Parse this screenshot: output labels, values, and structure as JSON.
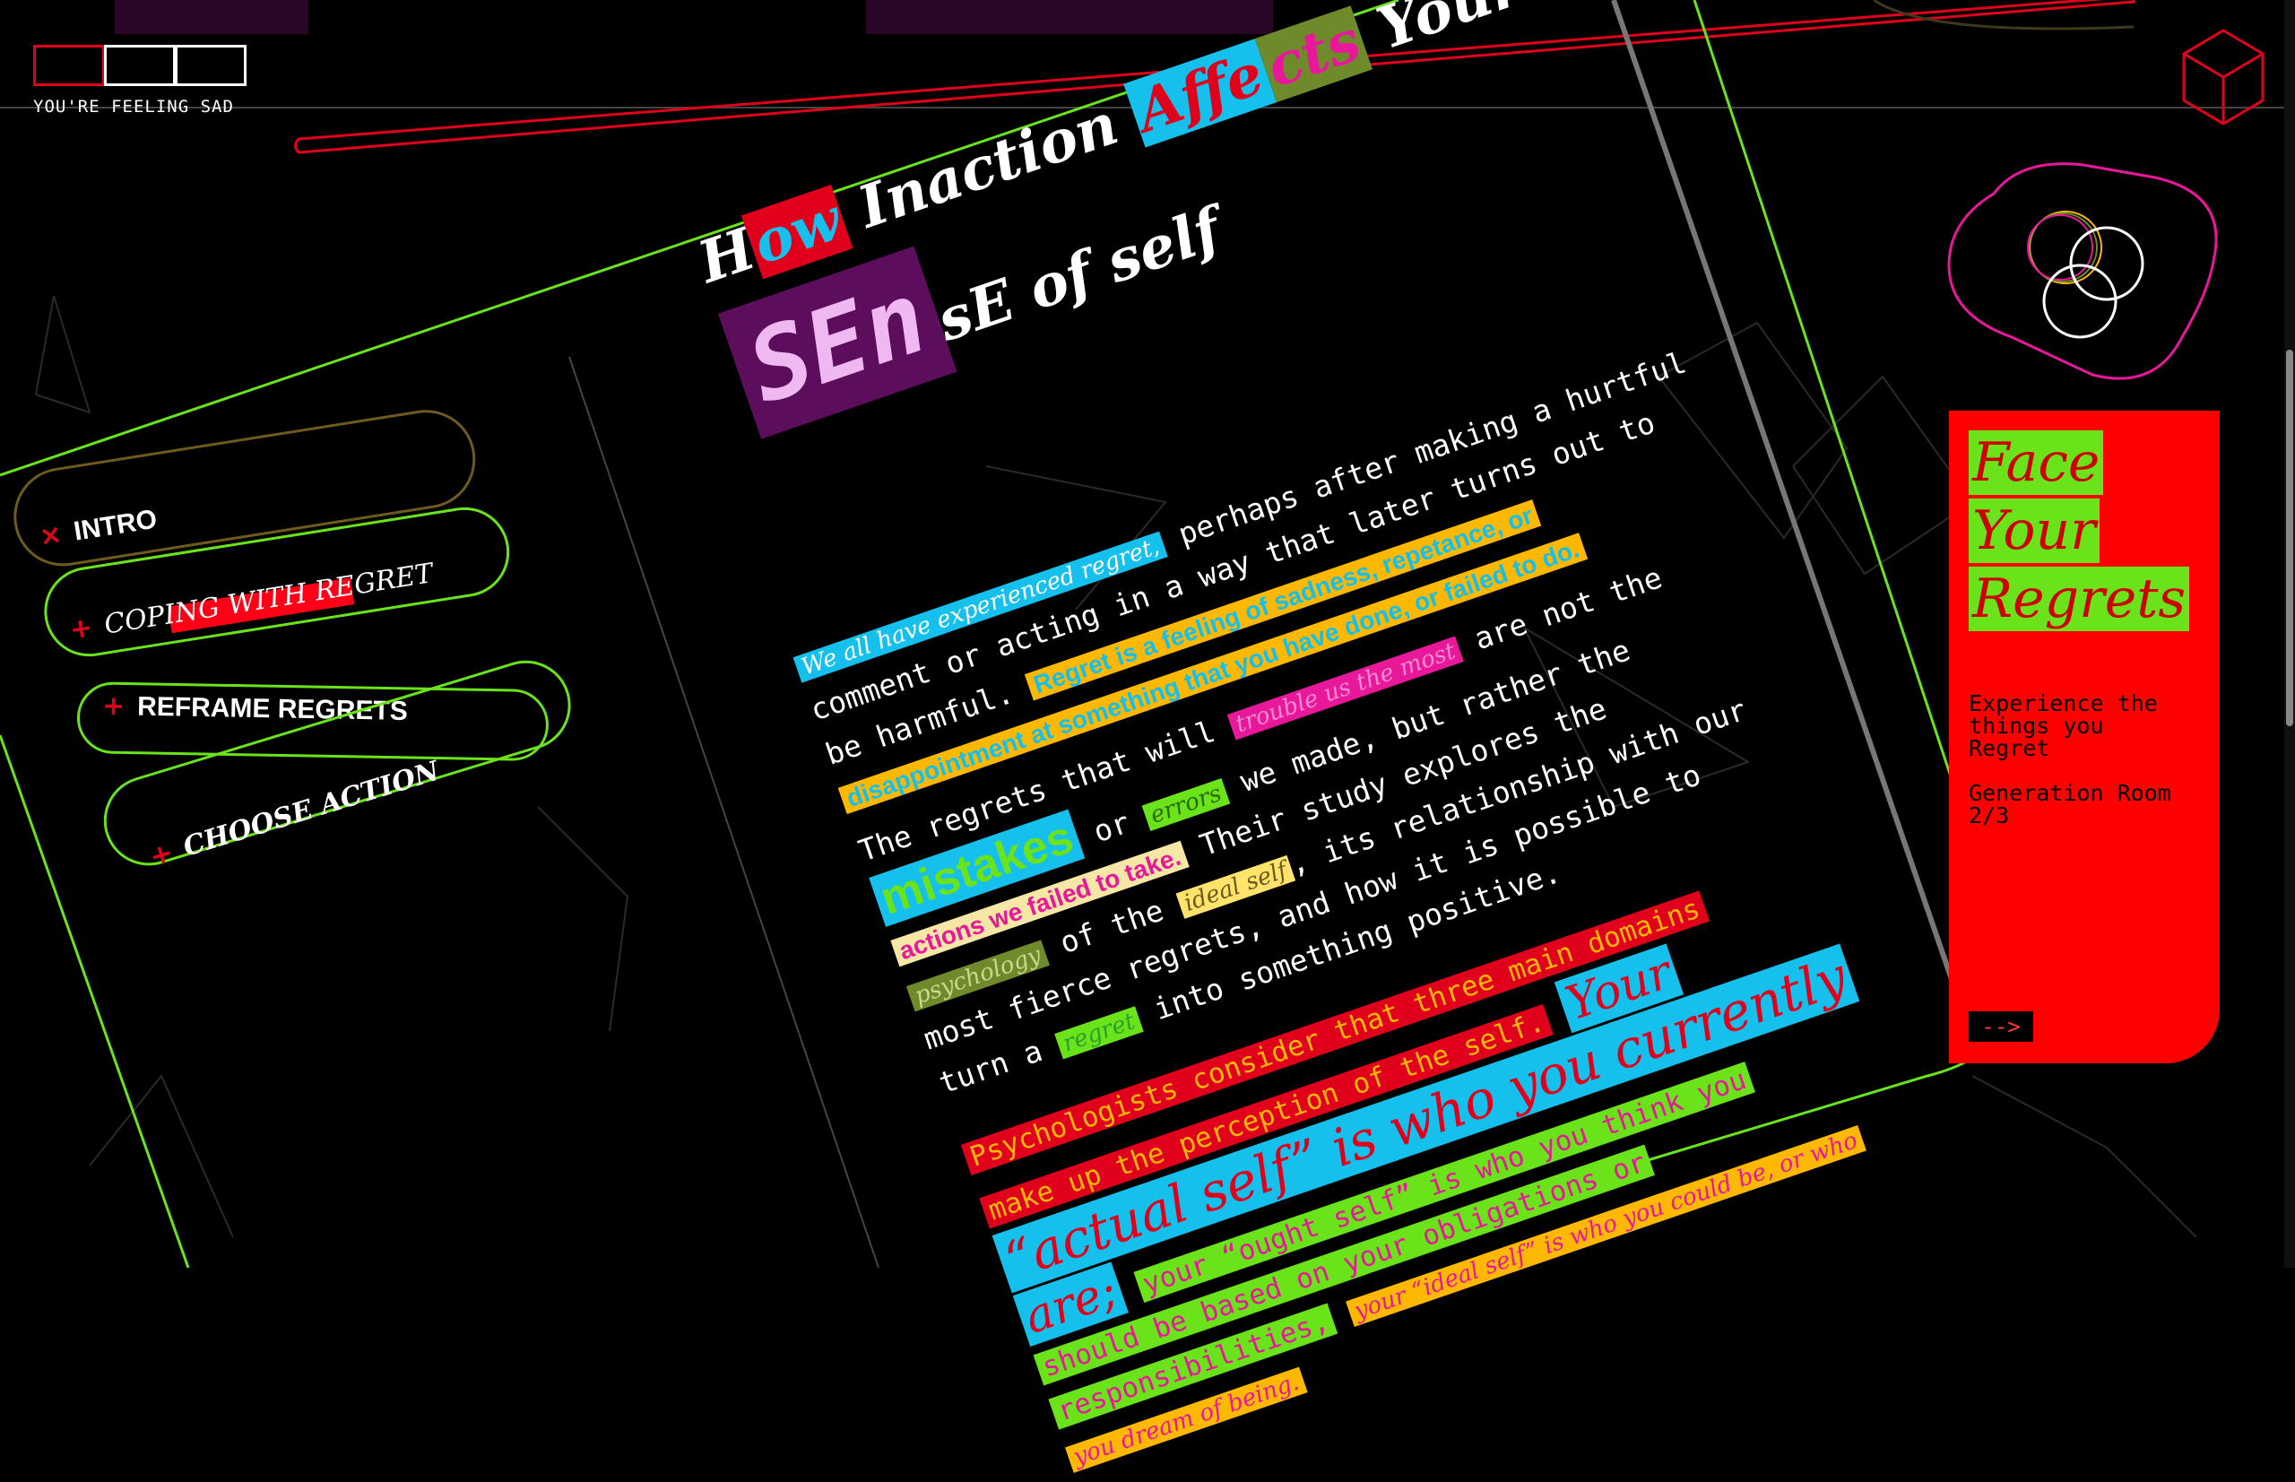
{
  "header": {
    "mood_label": "YOU'RE FEELING SAD"
  },
  "nav": {
    "intro": {
      "icon": "close-icon",
      "glyph": "×",
      "label": "INTRO"
    },
    "coping": {
      "icon": "plus-icon",
      "glyph": "+",
      "label": "COPING WITH REGRET"
    },
    "reframe": {
      "icon": "plus-icon",
      "glyph": "+",
      "label": "REFRAME REGRETS"
    },
    "choose": {
      "icon": "plus-icon",
      "glyph": "+",
      "label": "CHOOSE ACTION"
    }
  },
  "article": {
    "title": {
      "line1": {
        "a": "H",
        "b": "ow",
        "c": " Inaction ",
        "d": "Affe",
        "e": "cts",
        "f": " Your"
      },
      "line2": {
        "a": "SEn",
        "b": "sE of self"
      }
    },
    "body": {
      "p1_hl": "We all have experienced regret,",
      "p1_l1": " perhaps after making a hurtful",
      "p1_l2": "comment or acting in a way that later turns out to",
      "p1_l3a": "be harmful.",
      "p1_l3b": "Regret is a feeling of sadness, repetance, or",
      "p1_l4a": "disappointment at something that you have done, or failed to do.",
      "p2_l1a": "The regrets that will",
      "p2_l1b": "trouble us the most",
      "p2_l1c": " are not the",
      "p2_l2a": "mistakes",
      "p2_l2b": " or ",
      "p2_l2c": "errors",
      "p2_l2d": " we made, but rather the",
      "p2_l3a": "actions we failed to take.",
      "p2_l3b": " Their study explores the",
      "p2_l4a": " of the ",
      "p2_l4b": "ideal self",
      "p2_l4c": ", its relationship with our",
      "p2_l5a": "psychology",
      "p2_l5b": "most fierce regrets, and how it is possible to",
      "p2_l6a": "turn a ",
      "p2_l6b": "regret",
      "p2_l6c": " into something positive.",
      "p3_l1": "Psychologists consider that three main domains",
      "p3_l2a": "make up the perception of the self.",
      "p3_l2b": "Your",
      "p3_l3": "“actual self” is who you currently",
      "p3_l4a": "are;",
      "p3_l4b": "your “ought self” is who you think you",
      "p3_l5a": "should be based on your obligations or",
      "p3_l6a": "responsibilities,",
      "p3_l6b": "your “ideal self” is who you could be, or who",
      "p3_l7": "you dream of being."
    }
  },
  "panel": {
    "heading": [
      "Face",
      "Your",
      "Regrets"
    ],
    "subtitle": "Experience the things you Regret",
    "room": "Generation Room 2/3",
    "next_label": "-->"
  },
  "icons": {
    "cube": "cube-icon",
    "rings": "rings-icon"
  },
  "colors": {
    "accent_green": "#6be31b",
    "accent_red": "#ff0000",
    "highlight_cyan": "#15c0ec",
    "highlight_yellow": "#ffb800",
    "highlight_magenta": "#e7189a",
    "highlight_purple": "#5c0d5c",
    "highlight_olive": "#6e8a2a"
  }
}
